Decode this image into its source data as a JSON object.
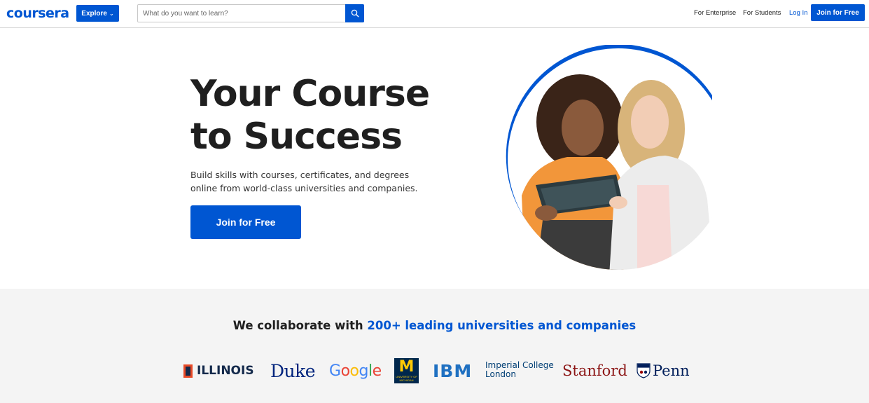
{
  "header": {
    "logo": "coursera",
    "explore_label": "Explore",
    "search_placeholder": "What do you want to learn?",
    "nav": {
      "enterprise": "For Enterprise",
      "students": "For Students",
      "login": "Log In",
      "join": "Join for Free"
    }
  },
  "hero": {
    "title_line1": "Your Course",
    "title_line2": "to Success",
    "subtitle": "Build skills with courses, certificates, and degrees online from world-class universities and companies.",
    "cta": "Join for Free"
  },
  "partners": {
    "heading_prefix": "We collaborate with ",
    "heading_highlight": "200+ leading universities and companies",
    "logos": {
      "illinois": "ILLINOIS",
      "duke": "Duke",
      "google": [
        "G",
        "o",
        "o",
        "g",
        "l",
        "e"
      ],
      "michigan": "M",
      "michigan_small": "UNIVERSITY OF MICHIGAN",
      "ibm": "IBM",
      "imperial_line1": "Imperial College",
      "imperial_line2": "London",
      "stanford": "Stanford",
      "penn": "Penn"
    }
  },
  "colors": {
    "brand_blue": "#0056d2",
    "text_dark": "#1f1f1f",
    "band_bg": "#f4f4f4",
    "google_colors": [
      "#4285f4",
      "#ea4335",
      "#fbbc05",
      "#4285f4",
      "#34a853",
      "#ea4335"
    ]
  },
  "icons": {
    "search": "search-icon",
    "explore_chevron": "chevron-down-icon"
  }
}
